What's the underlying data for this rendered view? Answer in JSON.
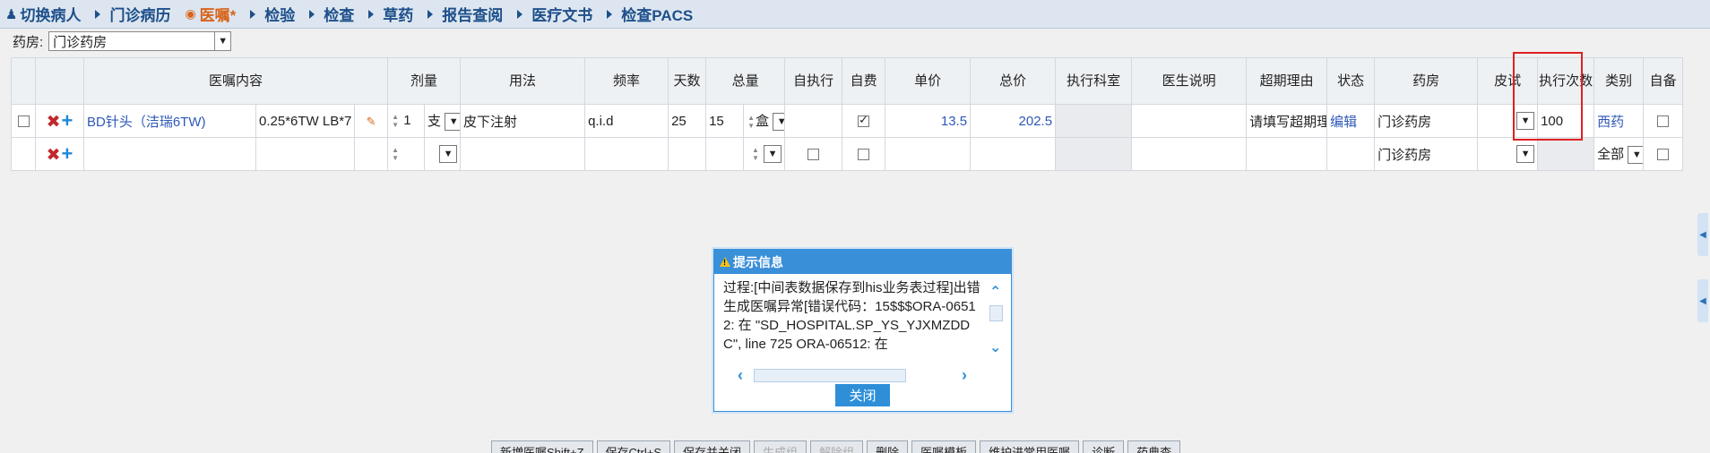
{
  "nav": {
    "items": [
      {
        "label": "切换病人",
        "icon": "user-icon",
        "active": false
      },
      {
        "label": "门诊病历",
        "icon": "triangle-right-icon",
        "active": false
      },
      {
        "label": "医嘱*",
        "icon": "location-pin-icon",
        "active": true
      },
      {
        "label": "检验",
        "icon": "triangle-right-icon",
        "active": false
      },
      {
        "label": "检查",
        "icon": "triangle-right-icon",
        "active": false
      },
      {
        "label": "草药",
        "icon": "triangle-right-icon",
        "active": false
      },
      {
        "label": "报告查阅",
        "icon": "triangle-right-icon",
        "active": false
      },
      {
        "label": "医疗文书",
        "icon": "triangle-right-icon",
        "active": false
      },
      {
        "label": "检查PACS",
        "icon": "triangle-right-icon",
        "active": false
      }
    ]
  },
  "pharmacy": {
    "label": "药房:",
    "value": "门诊药房"
  },
  "grid": {
    "headers": {
      "content": "医嘱内容",
      "dose": "剂量",
      "usage": "用法",
      "freq": "频率",
      "days": "天数",
      "total": "总量",
      "self_exec": "自执行",
      "self_pay": "自费",
      "unit_price": "单价",
      "total_price": "总价",
      "exec_dept": "执行科室",
      "doctor_note": "医生说明",
      "overdue_reason": "超期理由",
      "status": "状态",
      "pharmacy": "药房",
      "skin_test": "皮试",
      "exec_count": "执行次数",
      "category": "类别",
      "self_prepare": "自备"
    },
    "row1": {
      "name": "BD针头（洁瑞6TW)",
      "spec": "0.25*6TW LB*7",
      "dose": "1",
      "dose_unit": "支",
      "usage": "皮下注射",
      "freq": "q.i.d",
      "days": "25",
      "total": "15",
      "total_unit": "盒",
      "self_pay": true,
      "unit_price": "13.5",
      "total_price": "202.5",
      "overdue_reason": "请填写超期理由",
      "status": "编辑",
      "pharmacy": "门诊药房",
      "exec_count": "100",
      "category": "西药"
    },
    "row2": {
      "pharmacy": "门诊药房",
      "category": "全部"
    }
  },
  "dialog": {
    "title": "提示信息",
    "message": "过程:[中间表数据保存到his业务表过程]出错生成医嘱异常[错误代码：15$$$ORA-06512: 在 \"SD_HOSPITAL.SP_YS_YJXMZDDC\", line 725 ORA-06512: 在",
    "close_label": "关闭"
  },
  "toolbar": {
    "buttons": [
      {
        "label": "新増医嘱Shift+Z",
        "enabled": true
      },
      {
        "label": "保存Ctrl+S",
        "enabled": true
      },
      {
        "label": "保存并关闭",
        "enabled": true
      },
      {
        "label": "生成组",
        "enabled": false
      },
      {
        "label": "解除组",
        "enabled": false
      },
      {
        "label": "删除",
        "enabled": true
      },
      {
        "label": "医嘱模板",
        "enabled": true
      },
      {
        "label": "维护进常用医嘱",
        "enabled": true
      },
      {
        "label": "诊断",
        "enabled": true
      },
      {
        "label": "药典查",
        "enabled": true
      }
    ]
  },
  "colors": {
    "nav_text": "#1d4f8a",
    "active_nav": "#d8641a",
    "dialog_blue": "#3a8fd9",
    "highlight_red": "#e02020",
    "link_blue": "#2e58b8"
  }
}
